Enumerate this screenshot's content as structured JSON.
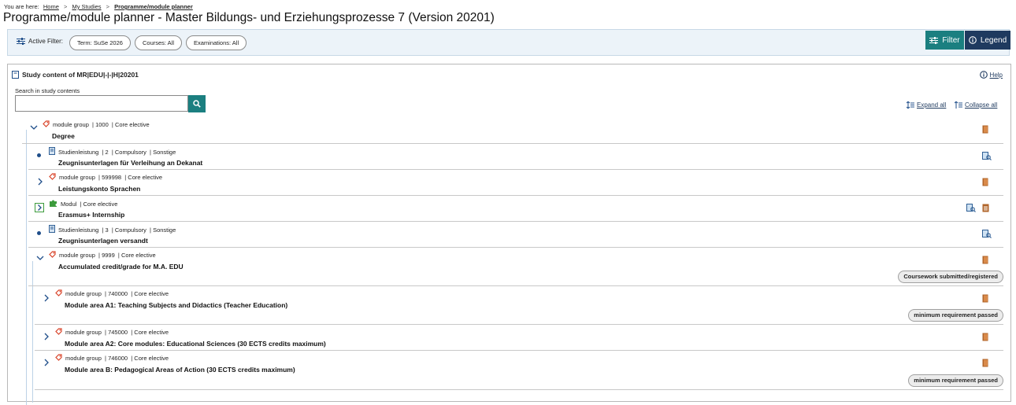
{
  "breadcrumb": {
    "prefix": "You are here:",
    "items": [
      "Home",
      "My Studies",
      "Programme/module planner"
    ]
  },
  "page": {
    "title": "Programme/module planner - Master Bildungs- und Erziehungsprozesse 7 (Version 20201)"
  },
  "filter": {
    "label": "Active Filter:",
    "pills": [
      "Term: SuSe 2026",
      "Courses: All",
      "Examinations: All"
    ],
    "filter_button": "Filter",
    "legend_button": "Legend"
  },
  "panel": {
    "title": "Study content of MR|EDU|-|-|H|20201",
    "help": "Help",
    "search_label": "Search in study contents",
    "search_value": "",
    "expand_all": "Expand all",
    "collapse_all": "Collapse all"
  },
  "rows": [
    {
      "meta": "module group  | 1000  | Core elective",
      "name": "Degree",
      "kind": "group",
      "state": "open",
      "icon": "tag-icon",
      "right": [
        "door-icon"
      ],
      "badge": ""
    },
    {
      "meta": "Studienleistung  | 2  | Compulsory  | Sonstige",
      "name": "Zeugnisunterlagen für Verleihung an Dekanat",
      "kind": "leaf",
      "state": "leaf",
      "icon": "document-icon",
      "right": [
        "search-doc-icon"
      ],
      "badge": ""
    },
    {
      "meta": "module group  | 599998  | Core elective",
      "name": "Leistungskonto Sprachen",
      "kind": "group",
      "state": "closed",
      "icon": "tag-icon",
      "right": [
        "door-icon"
      ],
      "badge": ""
    },
    {
      "meta": "Modul  | Core elective",
      "name": "Erasmus+ Internship",
      "kind": "module",
      "state": "boxed",
      "icon": "puzzle-icon",
      "right": [
        "search-doc-icon",
        "door-list-icon"
      ],
      "badge": ""
    },
    {
      "meta": "Studienleistung  | 3  | Compulsory  | Sonstige",
      "name": "Zeugnisunterlagen versandt",
      "kind": "leaf",
      "state": "leaf",
      "icon": "document-icon",
      "right": [
        "search-doc-icon"
      ],
      "badge": ""
    },
    {
      "meta": "module group  | 9999  | Core elective",
      "name": "Accumulated credit/grade for M.A. EDU",
      "kind": "group",
      "state": "open",
      "icon": "tag-icon",
      "right": [
        "door-icon"
      ],
      "badge": "Coursework submitted/registered"
    },
    {
      "meta": "module group  | 740000  | Core elective",
      "name": "Module area A1: Teaching Subjects and Didactics (Teacher Education)",
      "kind": "group",
      "state": "closed",
      "icon": "tag-icon",
      "right": [
        "door-icon"
      ],
      "badge": "minimum requirement passed"
    },
    {
      "meta": "module group  | 745000  | Core elective",
      "name": "Module area A2: Core modules: Educational Sciences (30 ECTS credits maximum)",
      "kind": "group",
      "state": "closed",
      "icon": "tag-icon",
      "right": [
        "door-icon"
      ],
      "badge": ""
    },
    {
      "meta": "module group  | 746000  | Core elective",
      "name": "Module area B: Pedagogical Areas of Action (30 ECTS credits maximum)",
      "kind": "group",
      "state": "closed",
      "icon": "tag-icon",
      "right": [
        "door-icon"
      ],
      "badge": "minimum requirement passed"
    }
  ],
  "colors": {
    "teal": "#1b7f80",
    "navy": "#1f3a5f",
    "link_blue": "#1f4e8a",
    "tag_red": "#d9452b",
    "door_brown": "#b0642a"
  }
}
